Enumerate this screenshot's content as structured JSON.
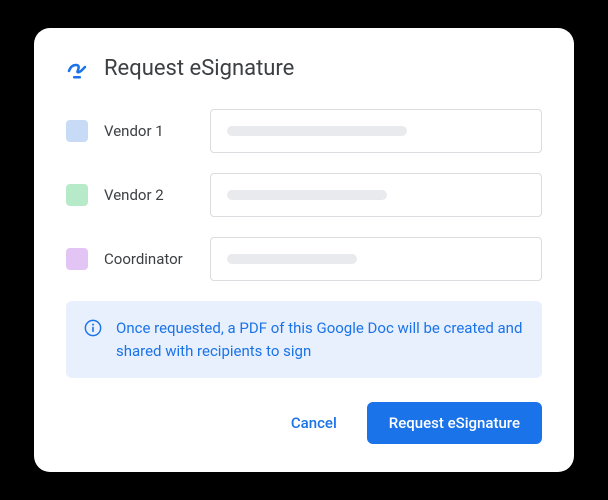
{
  "header": {
    "title": "Request eSignature"
  },
  "signers": [
    {
      "label": "Vendor 1",
      "color": "blue"
    },
    {
      "label": "Vendor 2",
      "color": "green"
    },
    {
      "label": "Coordinator",
      "color": "purple"
    }
  ],
  "info": {
    "text": "Once requested, a PDF of this Google Doc will be created and shared with recipients to sign"
  },
  "actions": {
    "cancel": "Cancel",
    "submit": "Request eSignature"
  }
}
